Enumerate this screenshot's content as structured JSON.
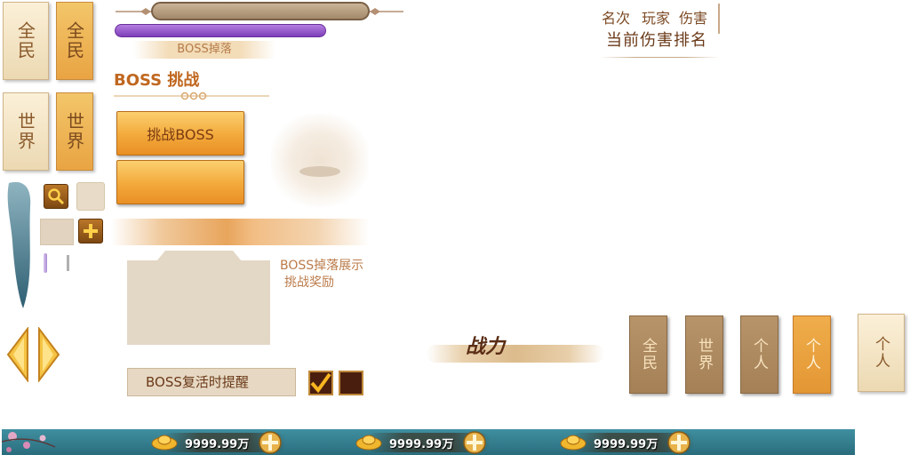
{
  "tabs_left": {
    "all_people_1": "全民",
    "all_people_2": "全民",
    "world_1": "世界",
    "world_2": "世界"
  },
  "boss_drop_label": "BOSS掉落",
  "boss_challenge_heading": "BOSS 挑战",
  "challenge_button_label": "挑战BOSS",
  "boss_drop_display": "BOSS掉落展示",
  "challenge_reward": "挑战奖励",
  "boss_revive_reminder": "BOSS复活时提醒",
  "reminder_checked": true,
  "rank_header": {
    "col_rank": "名次",
    "col_player": "玩家",
    "col_damage": "伤害",
    "title": "当前伤害排名"
  },
  "power_label": "战力",
  "tabs_right": {
    "all_people": "全民",
    "world": "世界",
    "personal_1": "个人",
    "personal_2": "个人",
    "personal_3": "个人"
  },
  "currency": [
    {
      "value": "9999.99万"
    },
    {
      "value": "9999.99万"
    },
    {
      "value": "9999.99万"
    }
  ],
  "colors": {
    "accent_gold": "#f3a93b",
    "accent_purple": "#9b5fd0",
    "text_brown": "#7c4a24",
    "bar_teal": "#3f8fa0"
  },
  "icons": {
    "search": "magnifier-icon",
    "add": "plus-icon",
    "check": "checkmark-icon",
    "nav_prev": "chevron-left-icon",
    "nav_next": "chevron-right-icon"
  }
}
